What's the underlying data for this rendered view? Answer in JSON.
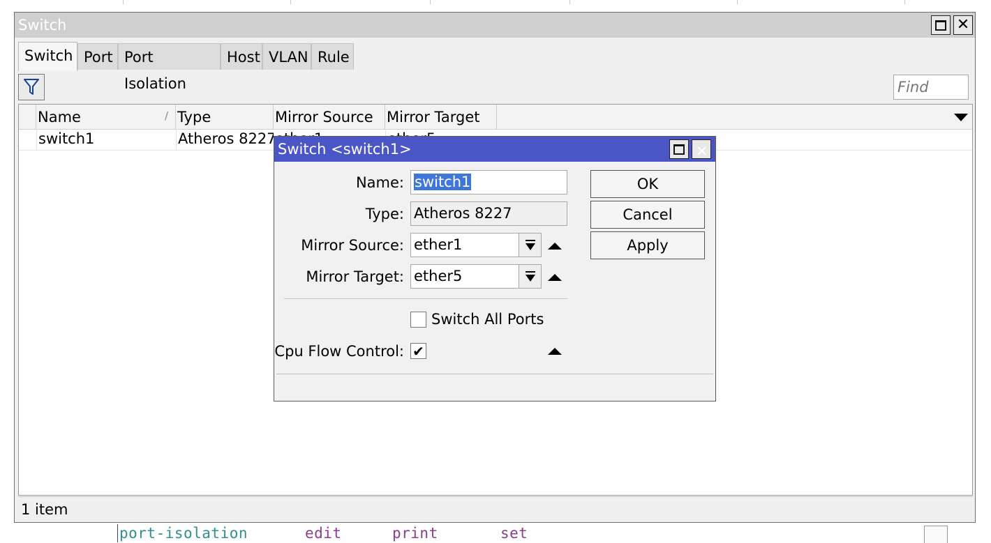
{
  "window": {
    "title": "Switch",
    "tabs": [
      "Switch",
      "Port",
      "Port Isolation",
      "Host",
      "VLAN",
      "Rule"
    ],
    "find_placeholder": "Find",
    "columns": [
      "Name",
      "Type",
      "Mirror Source",
      "Mirror Target"
    ],
    "rows": [
      {
        "name": "switch1",
        "type": "Atheros 8227",
        "mirror_source": "ether1",
        "mirror_target": "ether5"
      }
    ],
    "status": "1 item"
  },
  "dialog": {
    "title": "Switch <switch1>",
    "labels": {
      "name": "Name:",
      "type": "Type:",
      "mirror_source": "Mirror Source:",
      "mirror_target": "Mirror Target:",
      "switch_all_ports": "Switch All Ports",
      "cpu_flow_control": "Cpu Flow Control:"
    },
    "values": {
      "name": "switch1",
      "type": "Atheros 8227",
      "mirror_source": "ether1",
      "mirror_target": "ether5",
      "switch_all_ports": false,
      "cpu_flow_control": true
    },
    "buttons": {
      "ok": "OK",
      "cancel": "Cancel",
      "apply": "Apply"
    }
  },
  "terminal": {
    "words": [
      "port-isolation",
      "edit",
      "print",
      "set"
    ],
    "colors": {
      "command": "#2f8f8f",
      "keyword": "#8b3d8b"
    }
  },
  "icons": {
    "filter": "filter-icon",
    "maximize": "maximize-icon",
    "close": "close-icon",
    "dropdown": "dropdown-arrow-icon",
    "spin_up": "up-arrow-icon"
  },
  "colors": {
    "dialog_titlebar": "#4a55c6",
    "selection": "#3f76d9",
    "window_titlebar": "#cfcfcf"
  }
}
